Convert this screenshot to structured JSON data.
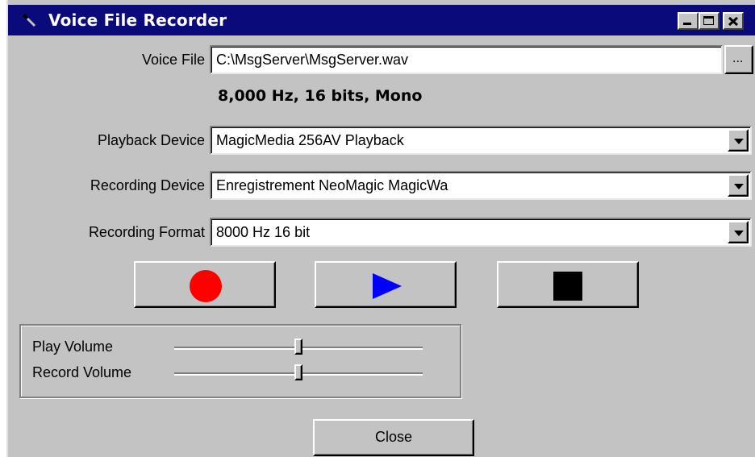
{
  "window": {
    "title": "Voice File Recorder",
    "icon": "microphone-icon",
    "controls": [
      "minimize-icon",
      "maximize-icon",
      "close-icon"
    ]
  },
  "voice_file": {
    "label": "Voice File",
    "value": "C:\\MsgServer\\MsgServer.wav",
    "browse_label": "..."
  },
  "format_info": "8,000 Hz, 16 bits, Mono",
  "playback_device": {
    "label": "Playback Device",
    "value": "MagicMedia 256AV Playback"
  },
  "recording_device": {
    "label": "Recording Device",
    "value": "Enregistrement NeoMagic MagicWa"
  },
  "recording_format": {
    "label": "Recording Format",
    "value": "8000 Hz 16 bit"
  },
  "transport": {
    "record": {
      "icon": "record-icon",
      "color": "#ff0000"
    },
    "play": {
      "icon": "play-icon",
      "color": "#0000ff"
    },
    "stop": {
      "icon": "stop-icon",
      "color": "#000000"
    }
  },
  "volume": {
    "play": {
      "label": "Play Volume",
      "level": 0.5
    },
    "record": {
      "label": "Record Volume",
      "level": 0.5
    }
  },
  "close_label": "Close",
  "colors": {
    "titlebar": "#0a0a7a",
    "face": "#c3c3c3"
  }
}
